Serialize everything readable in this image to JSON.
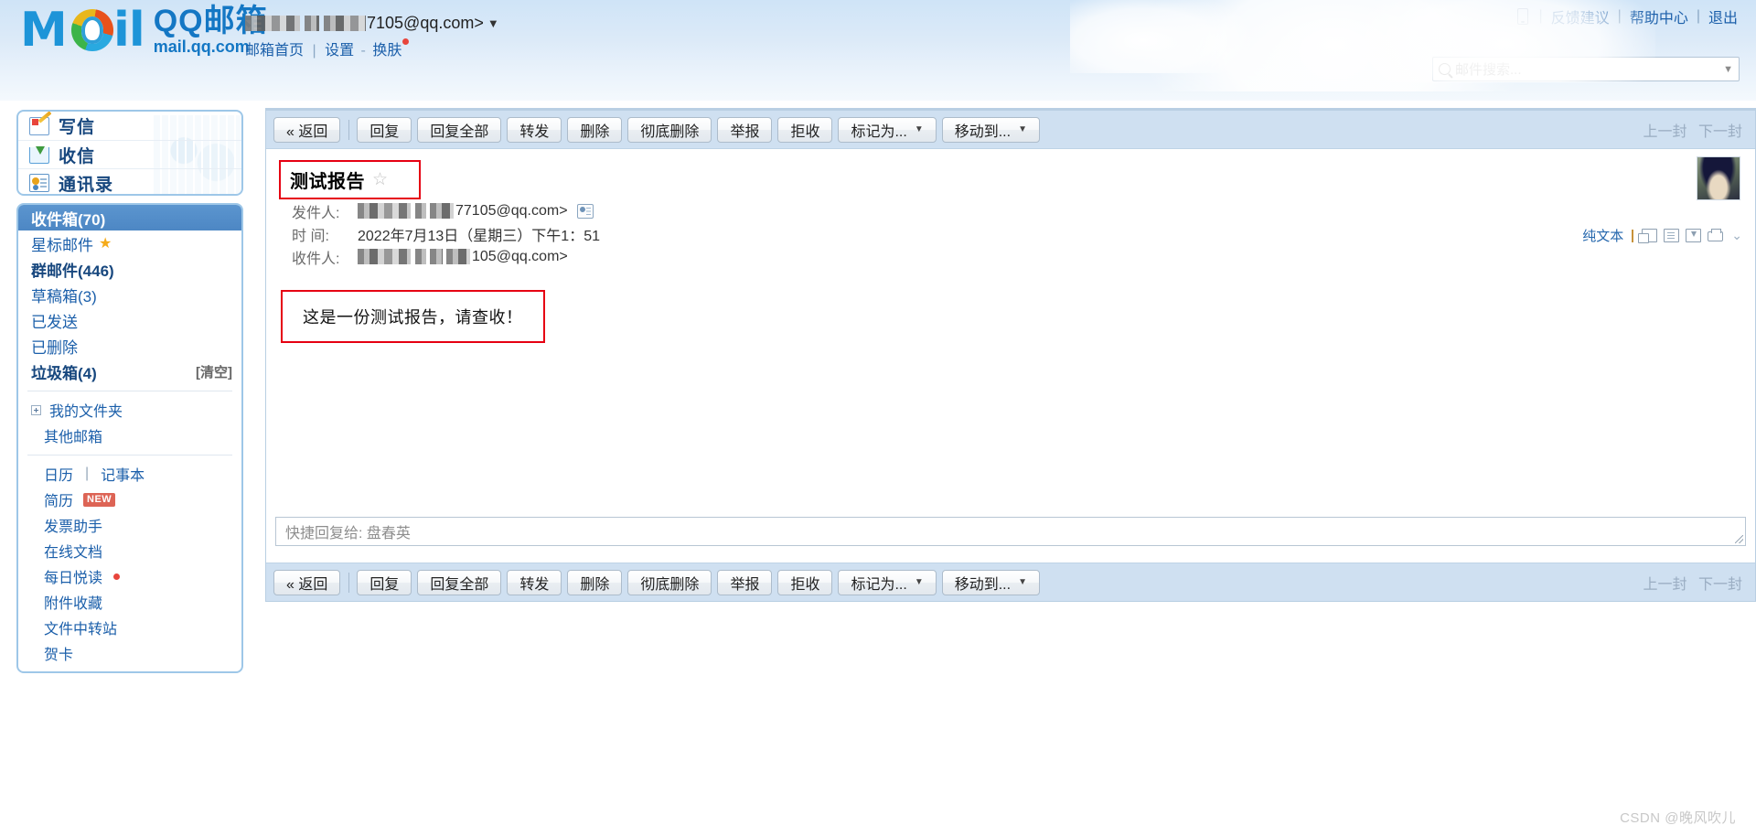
{
  "header": {
    "logo": {
      "cn": "QQ邮箱",
      "en": "mail.qq.com"
    },
    "account": {
      "email_suffix": "7105@qq.com>",
      "caret": "▼",
      "links": {
        "home": "邮箱首页",
        "settings": "设置",
        "skin": "换肤",
        "separator": "|",
        "dash": "-"
      }
    },
    "top_right": {
      "phone_icon": "phone-icon",
      "feedback": "反馈建议",
      "help": "帮助中心",
      "logout": "退出",
      "separator": "|"
    },
    "search": {
      "placeholder": "邮件搜索...",
      "icon": "search-icon",
      "caret": "▼"
    }
  },
  "sidebar": {
    "actions": [
      {
        "label": "写信",
        "icon": "compose-icon"
      },
      {
        "label": "收信",
        "icon": "inbox-download-icon"
      },
      {
        "label": "通讯录",
        "icon": "contacts-icon"
      }
    ],
    "folders": [
      {
        "label": "收件箱(70)",
        "selected": true,
        "bold": true
      },
      {
        "label": "星标邮件",
        "star": "★"
      },
      {
        "label": "群邮件(446)",
        "bold": true
      },
      {
        "label": "草稿箱(3)"
      },
      {
        "label": "已发送"
      },
      {
        "label": "已删除"
      },
      {
        "label": "垃圾箱(4)",
        "bold": true,
        "action": "[清空]"
      }
    ],
    "folder_groups": [
      {
        "label": "我的文件夹",
        "expandable": true
      },
      {
        "label": "其他邮箱"
      }
    ],
    "tools": {
      "calendar": "日历",
      "notes": "记事本",
      "separator": "|",
      "resume": "简历",
      "resume_badge": "NEW",
      "items": [
        {
          "label": "发票助手"
        },
        {
          "label": "在线文档"
        },
        {
          "label": "每日悦读",
          "dot": true
        },
        {
          "label": "附件收藏"
        },
        {
          "label": "文件中转站"
        },
        {
          "label": "贺卡"
        }
      ]
    }
  },
  "toolbar": {
    "back": "« 返回",
    "reply": "回复",
    "reply_all": "回复全部",
    "forward": "转发",
    "delete": "删除",
    "delete_permanently": "彻底删除",
    "report": "举报",
    "reject": "拒收",
    "mark_as": "标记为...",
    "move_to": "移动到...",
    "caret": "▼",
    "prev": "上一封",
    "next": "下一封"
  },
  "mail": {
    "subject": "测试报告",
    "star": "☆",
    "from_label": "发件人:",
    "from_value": "77105@qq.com>",
    "date_label": "时 间:",
    "date_value": "2022年7月13日（星期三）下午1：51",
    "to_label": "收件人:",
    "to_value": "105@qq.com>",
    "body": "这是一份测试报告，请查收！",
    "tools": {
      "plain_text": "纯文本",
      "icons": [
        "new-window-icon",
        "document-icon",
        "save-icon",
        "print-icon"
      ],
      "expand": "⌄"
    },
    "avatar": "sender-avatar"
  },
  "quick_reply": {
    "placeholder": "快捷回复给: 盘春英"
  },
  "watermark": "CSDN @晚风吹儿",
  "colors": {
    "accent": "#1b5faa",
    "selected_bg": "#4d87c4",
    "highlight_border": "#e60012",
    "toolbar_bg": "#cfe0f1"
  }
}
